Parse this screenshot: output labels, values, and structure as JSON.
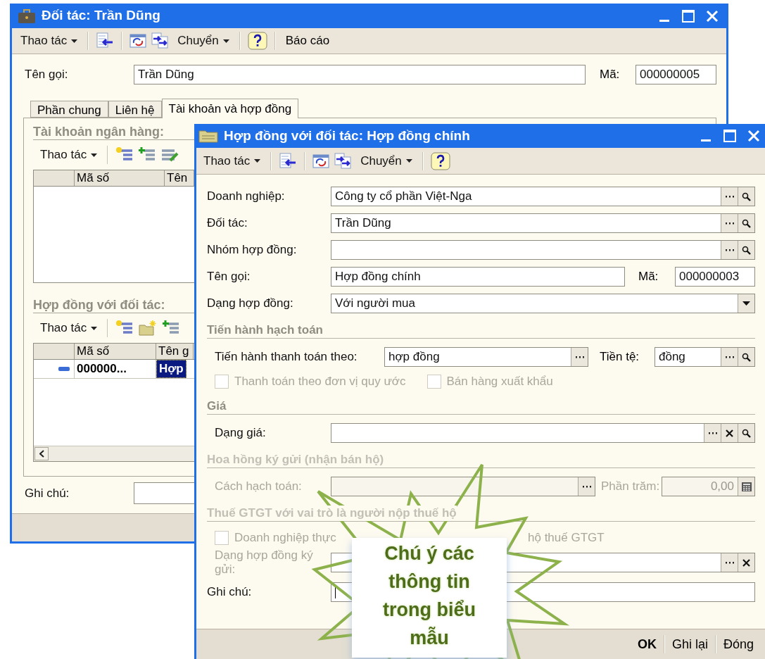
{
  "main_window": {
    "title": "Đối tác: Trần Dũng",
    "toolbar": {
      "actions": "Thao tác",
      "goto": "Chuyển",
      "report": "Báo cáo"
    },
    "name": {
      "label": "Tên gọi:",
      "value": "Trần Dũng"
    },
    "code": {
      "label": "Mã:",
      "value": "000000005"
    },
    "tabs": [
      {
        "label": "Phần chung",
        "selected": false
      },
      {
        "label": "Liên hệ",
        "selected": false
      },
      {
        "label": "Tài khoản và hợp đồng",
        "selected": true
      }
    ],
    "bank_accounts": {
      "title": "Tài khoản ngân hàng:",
      "actions": "Thao tác",
      "columns": [
        "Mã số",
        "Tên"
      ]
    },
    "contracts": {
      "title": "Hợp đồng với đối tác:",
      "actions": "Thao tác",
      "columns": [
        "Mã số",
        "Tên g"
      ],
      "rows": [
        {
          "code": "000000...",
          "name": "Hợp",
          "selected": true
        }
      ]
    },
    "note": {
      "label": "Ghi chú:"
    }
  },
  "contract_window": {
    "title": "Hợp đồng với đối tác: Hợp đồng chính",
    "toolbar": {
      "actions": "Thao tác",
      "goto": "Chuyển"
    },
    "rows": [
      {
        "kind": "lookup",
        "label": "Doanh nghiệp:",
        "value": "Công ty cổ phần Việt-Nga"
      },
      {
        "kind": "lookup",
        "label": "Đối tác:",
        "value": "Trần Dũng"
      },
      {
        "kind": "lookup",
        "label": "Nhóm hợp đồng:"
      },
      {
        "kind": "name",
        "label": "Tên gọi:",
        "value": "Hợp đồng chính",
        "code_label": "Mã:",
        "code_value": "000000003"
      },
      {
        "kind": "dropdown",
        "label": "Dạng hợp đồng:",
        "value": "Với người mua"
      }
    ],
    "sections": [
      {
        "title": "Tiến hành hạch toán",
        "disabled": false,
        "rows": [
          {
            "kind": "payment",
            "label": "Tiến hành thanh toán theo:",
            "value": "hợp đồng",
            "currency_label": "Tiền tệ:",
            "currency_value": "đồng"
          },
          {
            "kind": "checkboxes",
            "items": [
              {
                "label": "Thanh toán theo đơn vị quy ước",
                "checked": false,
                "disabled": true
              },
              {
                "label": "Bán hàng xuất khẩu",
                "checked": false,
                "disabled": true
              }
            ]
          }
        ]
      },
      {
        "title": "Giá",
        "disabled": false,
        "rows": [
          {
            "kind": "price",
            "label": "Dạng giá:",
            "disabled": false
          }
        ]
      },
      {
        "title": "Hoa hồng ký gửi (nhận bán hộ)",
        "disabled": true,
        "rows": [
          {
            "kind": "percent",
            "label": "Cách hạch toán:",
            "disabled": true,
            "percent_label": "Phần trăm:",
            "percent_value": "0,00"
          }
        ]
      },
      {
        "title": "Thuế GTGT với vai trò là người nộp thuế hộ",
        "disabled": true,
        "rows": [
          {
            "kind": "checkbox_split",
            "label_start": "Doanh nghiệp thực",
            "label_end": "hộ thuế GTGT",
            "checked": false,
            "disabled": true
          },
          {
            "kind": "consignment",
            "label": "Dạng hợp đồng ký gửi:",
            "disabled": true
          }
        ]
      }
    ],
    "note": {
      "label": "Ghi chú:",
      "focused": true
    },
    "buttons": [
      {
        "label": "OK",
        "default": true
      },
      {
        "label": "Ghi lại",
        "default": false
      },
      {
        "label": "Đóng",
        "default": false
      }
    ]
  },
  "callout": {
    "text": "Chú ý các thông tin trong biểu mẫu"
  }
}
